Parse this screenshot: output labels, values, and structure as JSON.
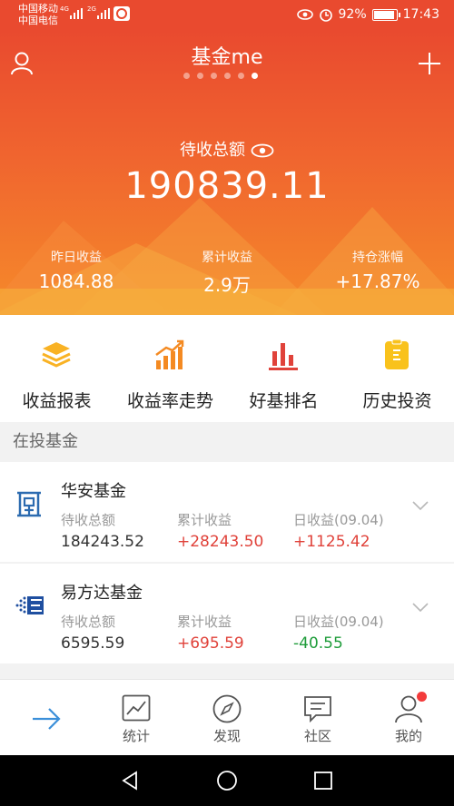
{
  "status_bar": {
    "carrier_1": "中国移动",
    "carrier_2": "中国电信",
    "network_1": "4G",
    "network_2": "2G",
    "battery": "92%",
    "battery_level": 0.92,
    "time": "17:43"
  },
  "header": {
    "title": "基金me",
    "page_count": 6,
    "active_page": 6
  },
  "summary": {
    "pending_label": "待收总额",
    "pending_total": "190839.11",
    "stats": [
      {
        "label": "昨日收益",
        "value": "1084.88"
      },
      {
        "label": "累计收益",
        "value": "2.9万"
      },
      {
        "label": "持仓涨幅",
        "value": "+17.87%"
      }
    ]
  },
  "menu": {
    "items": [
      {
        "label": "收益报表",
        "icon": "layers-icon"
      },
      {
        "label": "收益率走势",
        "icon": "trend-chart-icon"
      },
      {
        "label": "好基排名",
        "icon": "ranking-bars-icon"
      },
      {
        "label": "历史投资",
        "icon": "history-list-icon"
      }
    ]
  },
  "section": {
    "title": "在投基金"
  },
  "funds": [
    {
      "name": "华安基金",
      "pending_label": "待收总额",
      "pending_value": "184243.52",
      "cum_label": "累计收益",
      "cum_value": "+28243.50",
      "daily_label": "日收益(09.04)",
      "daily_value": "+1125.42"
    },
    {
      "name": "易方达基金",
      "pending_label": "待收总额",
      "pending_value": "6595.59",
      "cum_label": "累计收益",
      "cum_value": "+695.59",
      "daily_label": "日收益(09.04)",
      "daily_value": "-40.55"
    }
  ],
  "tabbar": {
    "tabs": [
      {
        "label": "",
        "icon": "arrow-right-icon"
      },
      {
        "label": "统计",
        "icon": "chart-icon"
      },
      {
        "label": "发现",
        "icon": "compass-icon"
      },
      {
        "label": "社区",
        "icon": "chat-icon"
      },
      {
        "label": "我的",
        "icon": "user-icon",
        "badge": true
      }
    ]
  },
  "colors": {
    "hero_top": "#e94a2f",
    "hero_bottom": "#f58a2a",
    "positive": "#e0423a",
    "negative": "#1e9c3a",
    "accent_blue": "#3b8fd9"
  }
}
